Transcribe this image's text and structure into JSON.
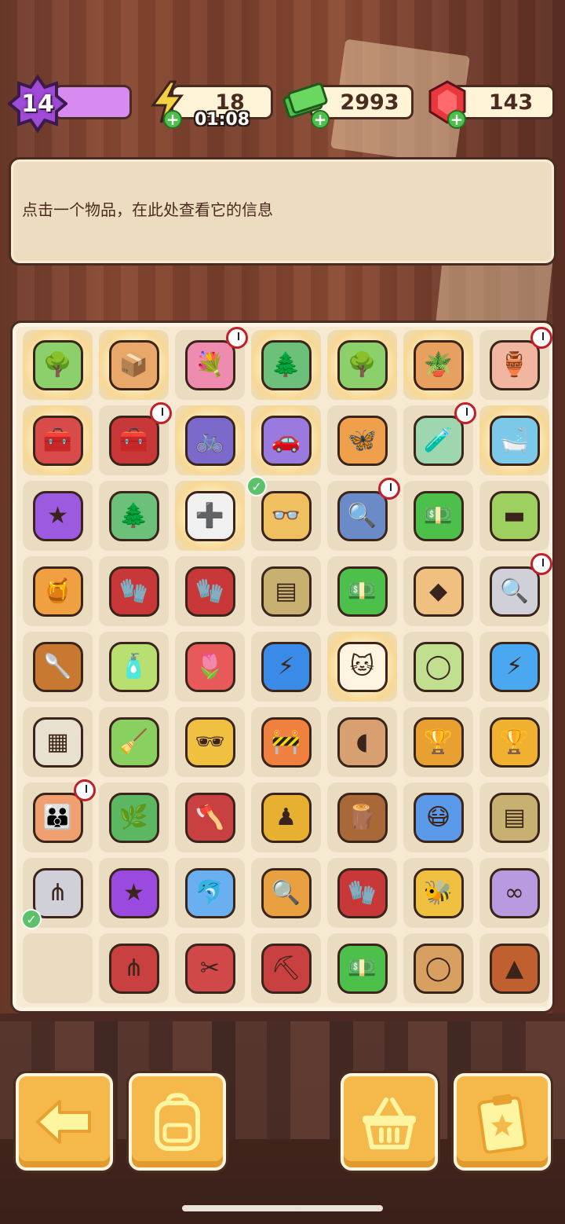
{
  "hud": {
    "level": "14",
    "energy": "18",
    "energy_timer": "01:08",
    "cash": "2993",
    "gems": "143"
  },
  "info_panel": {
    "text": "点击一个物品，在此处查看它的信息"
  },
  "board": {
    "cells": [
      {
        "name": "flowering-tree-item",
        "glyph": "🌳",
        "color": "#8bd06a",
        "glow": true
      },
      {
        "name": "crate-item",
        "glyph": "📦",
        "color": "#e9a86a",
        "glow": true
      },
      {
        "name": "flower-box-item",
        "glyph": "💐",
        "color": "#f08bb0",
        "timer": true
      },
      {
        "name": "bonsai-tree-item",
        "glyph": "🌲",
        "color": "#6cc07a",
        "glow": true
      },
      {
        "name": "flowering-tree-item",
        "glyph": "🌳",
        "color": "#8bd06a",
        "glow": true
      },
      {
        "name": "potted-plant-item",
        "glyph": "🪴",
        "color": "#e8a060",
        "glow": true
      },
      {
        "name": "vase-item",
        "glyph": "🏺",
        "color": "#f0b6a0",
        "timer": true
      },
      {
        "name": "red-toolbox-item",
        "glyph": "🧰",
        "color": "#d94a4a",
        "glow": true
      },
      {
        "name": "tool-chest-item",
        "glyph": "🧰",
        "color": "#c83838",
        "timer": true
      },
      {
        "name": "bicycle-item",
        "glyph": "🚲",
        "color": "#7b6acb",
        "glow": true
      },
      {
        "name": "purple-car-item",
        "glyph": "🚗",
        "color": "#9b7ae0",
        "glow": true
      },
      {
        "name": "butterfly-item",
        "glyph": "🦋",
        "color": "#f0a04a"
      },
      {
        "name": "herb-jar-item",
        "glyph": "🧪",
        "color": "#9ed6b0",
        "timer": true
      },
      {
        "name": "pool-item",
        "glyph": "🛁",
        "color": "#7cc8e8",
        "glow": true
      },
      {
        "name": "purple-star-item",
        "glyph": "★",
        "color": "#9b5ae0"
      },
      {
        "name": "small-bonsai-item",
        "glyph": "🌲",
        "color": "#6cc07a"
      },
      {
        "name": "first-aid-box-item",
        "glyph": "➕",
        "color": "#f0f0f0",
        "glow": true
      },
      {
        "name": "glasses-item",
        "glyph": "👓",
        "color": "#f0c060",
        "check": true
      },
      {
        "name": "evidence-tray-item",
        "glyph": "🔍",
        "color": "#6a8ac8",
        "timer": true
      },
      {
        "name": "cash-pile-item",
        "glyph": "💵",
        "color": "#4cc04a"
      },
      {
        "name": "green-cushion-item",
        "glyph": "▬",
        "color": "#9ed060"
      },
      {
        "name": "honey-jar-item",
        "glyph": "🍯",
        "color": "#f0a040"
      },
      {
        "name": "red-gloves-item",
        "glyph": "🧤",
        "color": "#c83838"
      },
      {
        "name": "red-gloves-item",
        "glyph": "🧤",
        "color": "#c83838"
      },
      {
        "name": "paper-stack-item",
        "glyph": "▤",
        "color": "#c8b070"
      },
      {
        "name": "cash-stack-item",
        "glyph": "💵",
        "color": "#4cc04a"
      },
      {
        "name": "cracker-item",
        "glyph": "◆",
        "color": "#f0c080"
      },
      {
        "name": "evidence-box-item",
        "glyph": "🔍",
        "color": "#d0d0d8",
        "timer": true
      },
      {
        "name": "honey-dipper-item",
        "glyph": "🥄",
        "color": "#c87830"
      },
      {
        "name": "soap-bottle-item",
        "glyph": "🧴",
        "color": "#b8e070"
      },
      {
        "name": "flower-basket-item",
        "glyph": "🌷",
        "color": "#e85a5a"
      },
      {
        "name": "energy-orb-item",
        "glyph": "⚡",
        "color": "#3a8ae8"
      },
      {
        "name": "lucky-cat-item",
        "glyph": "🐱",
        "color": "#fff4e0",
        "glow": true
      },
      {
        "name": "melon-item",
        "glyph": "◯",
        "color": "#c0e090"
      },
      {
        "name": "energy-orb-item",
        "glyph": "⚡",
        "color": "#4aa8f0"
      },
      {
        "name": "evidence-bag-item",
        "glyph": "▦",
        "color": "#e8e0d0"
      },
      {
        "name": "broom-item",
        "glyph": "🧹",
        "color": "#8ad060"
      },
      {
        "name": "sunglasses-item",
        "glyph": "🕶",
        "color": "#f0c040"
      },
      {
        "name": "road-barrier-item",
        "glyph": "🚧",
        "color": "#f08040"
      },
      {
        "name": "clay-shard-item",
        "glyph": "◖",
        "color": "#d8a070"
      },
      {
        "name": "golden-statue-item",
        "glyph": "🏆",
        "color": "#e8a030"
      },
      {
        "name": "star-trophy-item",
        "glyph": "🏆",
        "color": "#f0b030"
      },
      {
        "name": "family-portrait-item",
        "glyph": "👪",
        "color": "#f0a070",
        "timer": true
      },
      {
        "name": "leaf-sprout-item",
        "glyph": "🌿",
        "color": "#5cb860"
      },
      {
        "name": "axe-item",
        "glyph": "🪓",
        "color": "#c84040"
      },
      {
        "name": "figurine-item",
        "glyph": "♟",
        "color": "#e8b030"
      },
      {
        "name": "tree-stump-item",
        "glyph": "🪵",
        "color": "#a86838"
      },
      {
        "name": "gas-mask-item",
        "glyph": "😷",
        "color": "#5a9ae8"
      },
      {
        "name": "hay-bale-item",
        "glyph": "▤",
        "color": "#c8b070"
      },
      {
        "name": "rake-item",
        "glyph": "⋔",
        "color": "#d0d0d8",
        "check_bl": true
      },
      {
        "name": "purple-star-item",
        "glyph": "★",
        "color": "#9b4ae0"
      },
      {
        "name": "dolphin-item",
        "glyph": "🐬",
        "color": "#6ab0f0"
      },
      {
        "name": "magnifying-glass-item",
        "glyph": "🔍",
        "color": "#e8a040"
      },
      {
        "name": "red-gloves-item",
        "glyph": "🧤",
        "color": "#c83838"
      },
      {
        "name": "bee-item",
        "glyph": "🐝",
        "color": "#f0c040"
      },
      {
        "name": "purple-beads-item",
        "glyph": "∞",
        "color": "#b89ae0"
      },
      {
        "name": "empty-cell",
        "glyph": "",
        "color": ""
      },
      {
        "name": "hand-fork-item",
        "glyph": "⋔",
        "color": "#c84040"
      },
      {
        "name": "pruning-shears-item",
        "glyph": "✂",
        "color": "#d04848"
      },
      {
        "name": "trowel-item",
        "glyph": "⛏",
        "color": "#c84040"
      },
      {
        "name": "cash-bundle-item",
        "glyph": "💵",
        "color": "#4cc04a"
      },
      {
        "name": "log-slice-item",
        "glyph": "◯",
        "color": "#d8a060"
      },
      {
        "name": "traffic-cone-item",
        "glyph": "▲",
        "color": "#c06030"
      }
    ]
  },
  "colors": {
    "panel": "#eddcbf",
    "board": "#f6ead3",
    "button": "#f5b94b",
    "outline": "#4a2b1f"
  }
}
